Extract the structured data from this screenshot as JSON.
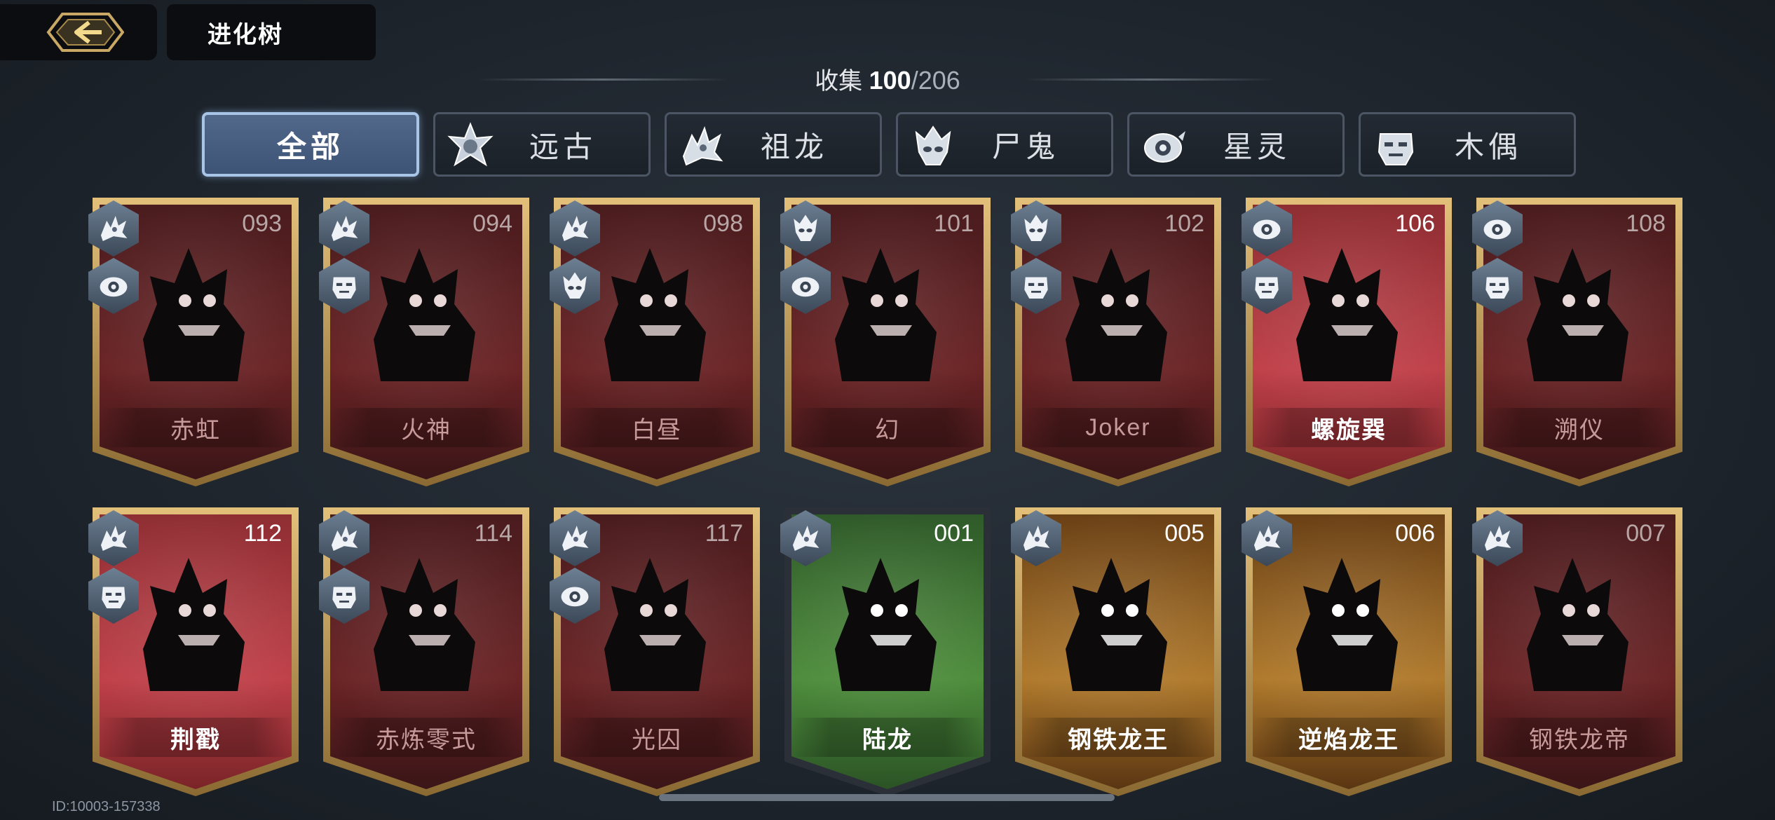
{
  "header": {
    "title": "进化树",
    "back_icon": "back-arrow-icon"
  },
  "collection": {
    "label": "收集",
    "collected": "100",
    "separator": "/",
    "total": "206"
  },
  "tabs": [
    {
      "label": "全部",
      "active": true,
      "icon": ""
    },
    {
      "label": "远古",
      "active": false,
      "icon": "ancient-icon"
    },
    {
      "label": "祖龙",
      "active": false,
      "icon": "ancestral-dragon-icon"
    },
    {
      "label": "尸鬼",
      "active": false,
      "icon": "ghoul-icon"
    },
    {
      "label": "星灵",
      "active": false,
      "icon": "star-spirit-icon"
    },
    {
      "label": "木偶",
      "active": false,
      "icon": "puppet-icon"
    }
  ],
  "cards": [
    {
      "number": "093",
      "name": "赤虹",
      "style": "dark",
      "badges": [
        "ancestral-dragon-icon",
        "star-spirit-icon"
      ]
    },
    {
      "number": "094",
      "name": "火神",
      "style": "dark",
      "badges": [
        "ancestral-dragon-icon",
        "puppet-icon"
      ]
    },
    {
      "number": "098",
      "name": "白昼",
      "style": "dark",
      "badges": [
        "ancestral-dragon-icon",
        "ghoul-icon"
      ]
    },
    {
      "number": "101",
      "name": "幻",
      "style": "dark",
      "badges": [
        "ghoul-icon",
        "star-spirit-icon"
      ]
    },
    {
      "number": "102",
      "name": "Joker",
      "style": "dark",
      "badges": [
        "ghoul-icon",
        "puppet-icon"
      ]
    },
    {
      "number": "106",
      "name": "螺旋巽",
      "style": "bright",
      "badges": [
        "star-spirit-icon",
        "puppet-icon"
      ]
    },
    {
      "number": "108",
      "name": "溯仪",
      "style": "dark",
      "badges": [
        "star-spirit-icon",
        "puppet-icon"
      ]
    },
    {
      "number": "112",
      "name": "荆戳",
      "style": "bright",
      "badges": [
        "ancestral-dragon-icon",
        "puppet-icon"
      ]
    },
    {
      "number": "114",
      "name": "赤炼零式",
      "style": "dark",
      "badges": [
        "ancestral-dragon-icon",
        "puppet-icon"
      ]
    },
    {
      "number": "117",
      "name": "光囚",
      "style": "dark",
      "badges": [
        "ancestral-dragon-icon",
        "star-spirit-icon"
      ]
    },
    {
      "number": "001",
      "name": "陆龙",
      "style": "green",
      "badges": [
        "ancestral-dragon-icon"
      ]
    },
    {
      "number": "005",
      "name": "钢铁龙王",
      "style": "orange",
      "badges": [
        "ancestral-dragon-icon"
      ]
    },
    {
      "number": "006",
      "name": "逆焰龙王",
      "style": "orange",
      "badges": [
        "ancestral-dragon-icon"
      ]
    },
    {
      "number": "007",
      "name": "钢铁龙帝",
      "style": "dark",
      "badges": [
        "ancestral-dragon-icon"
      ]
    }
  ],
  "footer": {
    "player_id": "ID:10003-157338"
  }
}
